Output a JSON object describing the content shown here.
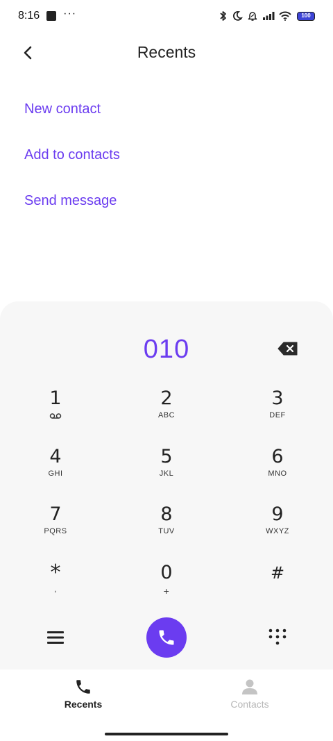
{
  "status_bar": {
    "time": "8:16",
    "more": "···",
    "battery": "100",
    "battery_color": "#3d44d6"
  },
  "header": {
    "title": "Recents",
    "back_icon": "chevron-left-icon"
  },
  "actions": {
    "new_contact": "New contact",
    "add_to_contacts": "Add to contacts",
    "send_message": "Send message"
  },
  "dialpad": {
    "number": "010",
    "keys": [
      {
        "digit": "1",
        "letters": ""
      },
      {
        "digit": "2",
        "letters": "ABC"
      },
      {
        "digit": "3",
        "letters": "DEF"
      },
      {
        "digit": "4",
        "letters": "GHI"
      },
      {
        "digit": "5",
        "letters": "JKL"
      },
      {
        "digit": "6",
        "letters": "MNO"
      },
      {
        "digit": "7",
        "letters": "PQRS"
      },
      {
        "digit": "8",
        "letters": "TUV"
      },
      {
        "digit": "9",
        "letters": "WXYZ"
      },
      {
        "digit": "*",
        "letters": ","
      },
      {
        "digit": "0",
        "letters": "+"
      },
      {
        "digit": "#",
        "letters": ""
      }
    ]
  },
  "bottom_nav": {
    "recents": "Recents",
    "contacts": "Contacts"
  },
  "colors": {
    "accent": "#6b3cf0",
    "panel": "#f7f7f7",
    "inactive": "#b7b7b7"
  }
}
